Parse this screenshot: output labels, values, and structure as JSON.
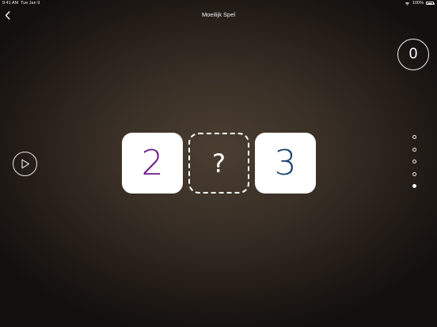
{
  "status_bar": {
    "time": "9:41 AM",
    "date": "Tue Jan 9",
    "battery": "100%"
  },
  "header": {
    "title": "Moeilijk Spel",
    "back_icon": "chevron-left-icon"
  },
  "score": {
    "value": "0"
  },
  "play": {
    "icon": "play-icon"
  },
  "sequence": {
    "left": "2",
    "missing": "?",
    "right": "3",
    "colors": {
      "left": "#6a1a80",
      "right": "#163f6c"
    }
  },
  "pagination": {
    "total": 5,
    "active_index": 4
  }
}
